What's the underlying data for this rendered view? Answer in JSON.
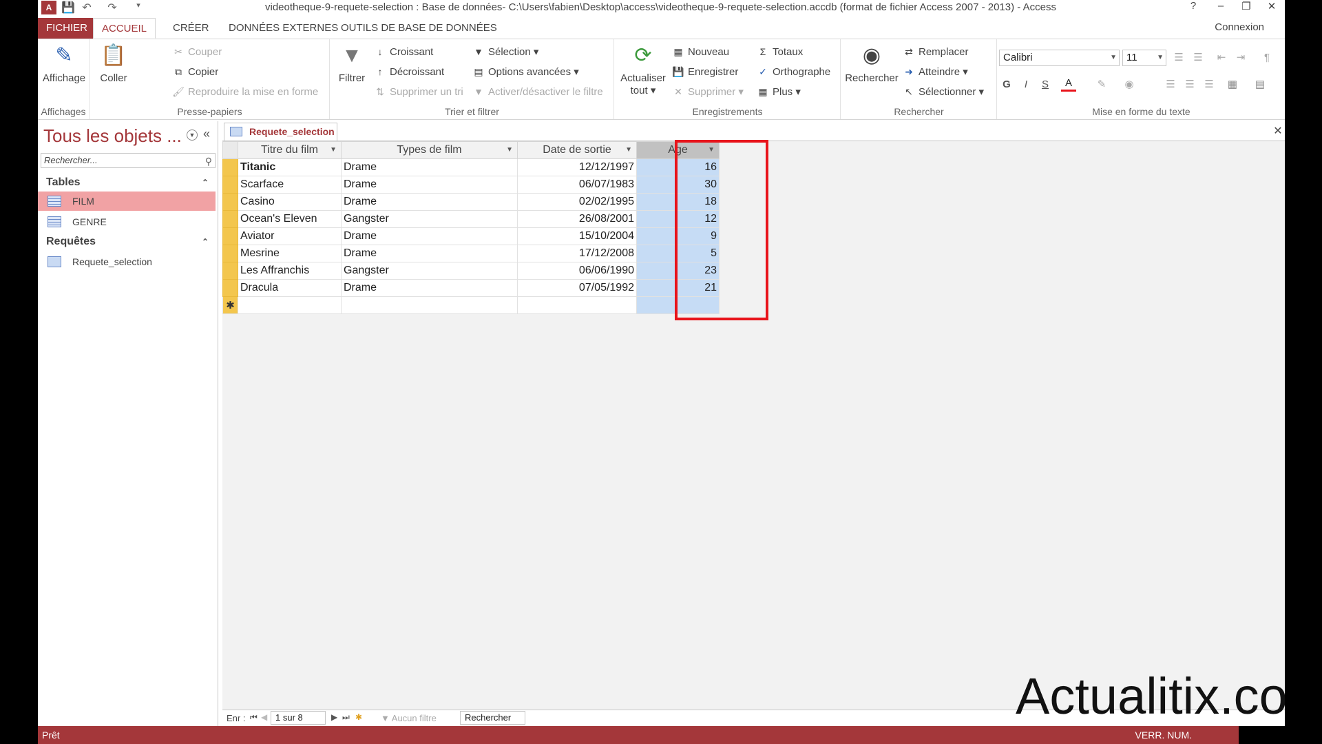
{
  "window": {
    "title": "videotheque-9-requete-selection : Base de données- C:\\Users\\fabien\\Desktop\\access\\videotheque-9-requete-selection.accdb (format de fichier Access 2007 - 2013) - Access",
    "help": "?",
    "minimize": "–",
    "restore": "❐",
    "close": "✕"
  },
  "tabs": [
    {
      "label": "FICHIER"
    },
    {
      "label": "ACCUEIL"
    },
    {
      "label": "CRÉER"
    },
    {
      "label": "DONNÉES EXTERNES"
    },
    {
      "label": "OUTILS DE BASE DE DONNÉES"
    }
  ],
  "account": {
    "label": "Connexion"
  },
  "ribbon": {
    "affichages": {
      "label": "Affichages",
      "affichage": "Affichage"
    },
    "presse_papiers": {
      "label": "Presse-papiers",
      "coller": "Coller",
      "couper": "Couper",
      "copier": "Copier",
      "reproduire": "Reproduire la mise en forme"
    },
    "trier_filtrer": {
      "label": "Trier et filtrer",
      "filtrer": "Filtrer",
      "croissant": "Croissant",
      "decroissant": "Décroissant",
      "supprimer_tri": "Supprimer un tri",
      "selection": "Sélection",
      "options_avancees": "Options avancées",
      "activer_filtre": "Activer/désactiver le filtre"
    },
    "enregistrements": {
      "label": "Enregistrements",
      "actualiser": "Actualiser",
      "actualiser2": "tout",
      "nouveau": "Nouveau",
      "enregistrer": "Enregistrer",
      "supprimer": "Supprimer",
      "totaux": "Totaux",
      "orthographe": "Orthographe",
      "plus": "Plus"
    },
    "rechercher": {
      "label": "Rechercher",
      "rechercher": "Rechercher",
      "remplacer": "Remplacer",
      "atteindre": "Atteindre",
      "selectionner": "Sélectionner"
    },
    "mise_en_forme": {
      "label": "Mise en forme du texte",
      "font": "Calibri",
      "size": "11",
      "bold": "G",
      "italic": "I",
      "underline": "S"
    }
  },
  "nav": {
    "title": "Tous les objets ...",
    "search_placeholder": "Rechercher...",
    "categories": [
      {
        "label": "Tables",
        "items": [
          "FILM",
          "GENRE"
        ]
      },
      {
        "label": "Requêtes",
        "items": [
          "Requete_selection"
        ]
      }
    ]
  },
  "document": {
    "tab_label": "Requete_selection",
    "columns": [
      "Titre du film",
      "Types de film",
      "Date de sortie",
      "Age"
    ],
    "rows": [
      [
        "Titanic",
        "Drame",
        "12/12/1997",
        "16"
      ],
      [
        "Scarface",
        "Drame",
        "06/07/1983",
        "30"
      ],
      [
        "Casino",
        "Drame",
        "02/02/1995",
        "18"
      ],
      [
        "Ocean's Eleven",
        "Gangster",
        "26/08/2001",
        "12"
      ],
      [
        "Aviator",
        "Drame",
        "15/10/2004",
        "9"
      ],
      [
        "Mesrine",
        "Drame",
        "17/12/2008",
        "5"
      ],
      [
        "Les Affranchis",
        "Gangster",
        "06/06/1990",
        "23"
      ],
      [
        "Dracula",
        "Drame",
        "07/05/1992",
        "21"
      ]
    ],
    "new_row_marker": "✱"
  },
  "recnav": {
    "label": "Enr :",
    "current": "1 sur 8",
    "filter": "Aucun filtre",
    "search": "Rechercher"
  },
  "status": {
    "left": "Prêt",
    "right": "VERR. NUM."
  },
  "watermark": "Actualitix.com",
  "colors": {
    "accent": "#a4373a",
    "highlight": "#e8141b",
    "selector": "#f3c64d",
    "age_column": "#c6dcf5"
  }
}
